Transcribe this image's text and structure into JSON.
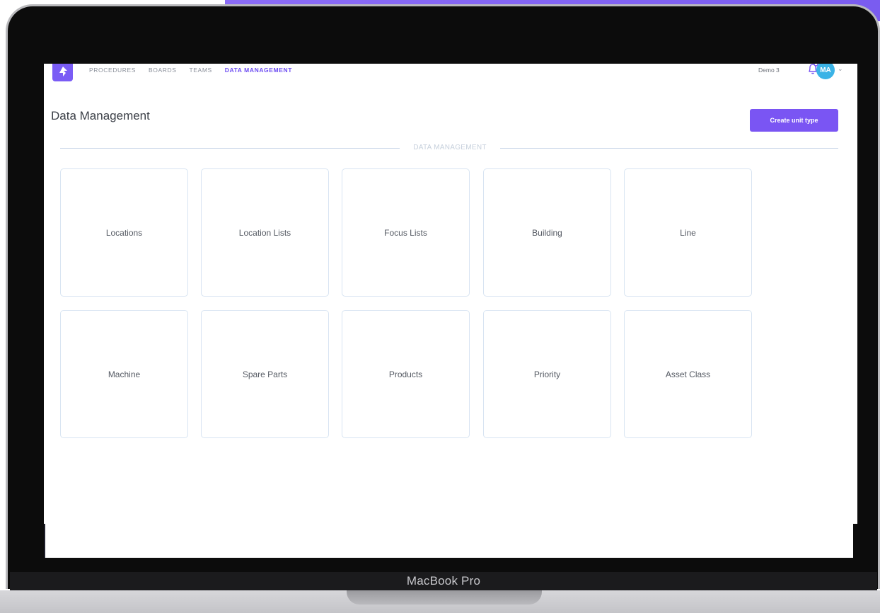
{
  "device_label": "MacBook Pro",
  "nav": {
    "items": [
      {
        "label": "PROCEDURES",
        "active": false
      },
      {
        "label": "BOARDS",
        "active": false
      },
      {
        "label": "TEAMS",
        "active": false
      },
      {
        "label": "DATA MANAGEMENT",
        "active": true
      }
    ]
  },
  "user": {
    "workspace": "Demo 3",
    "avatar_initials": "MA",
    "avatar_color": "#3bb3e6"
  },
  "page": {
    "title": "Data Management",
    "create_button": "Create unit type",
    "section_label": "DATA MANAGEMENT"
  },
  "cards": [
    {
      "label": "Locations"
    },
    {
      "label": "Location Lists"
    },
    {
      "label": "Focus Lists"
    },
    {
      "label": "Building"
    },
    {
      "label": "Line"
    },
    {
      "label": "Machine"
    },
    {
      "label": "Spare Parts"
    },
    {
      "label": "Products"
    },
    {
      "label": "Priority"
    },
    {
      "label": "Asset Class"
    }
  ],
  "colors": {
    "accent": "#7a55f3",
    "card_border": "#d8e4f2"
  },
  "icons": {
    "logo": "app-logo-icon",
    "bell": "notification-bell-icon",
    "chevron": "chevron-down-icon"
  }
}
